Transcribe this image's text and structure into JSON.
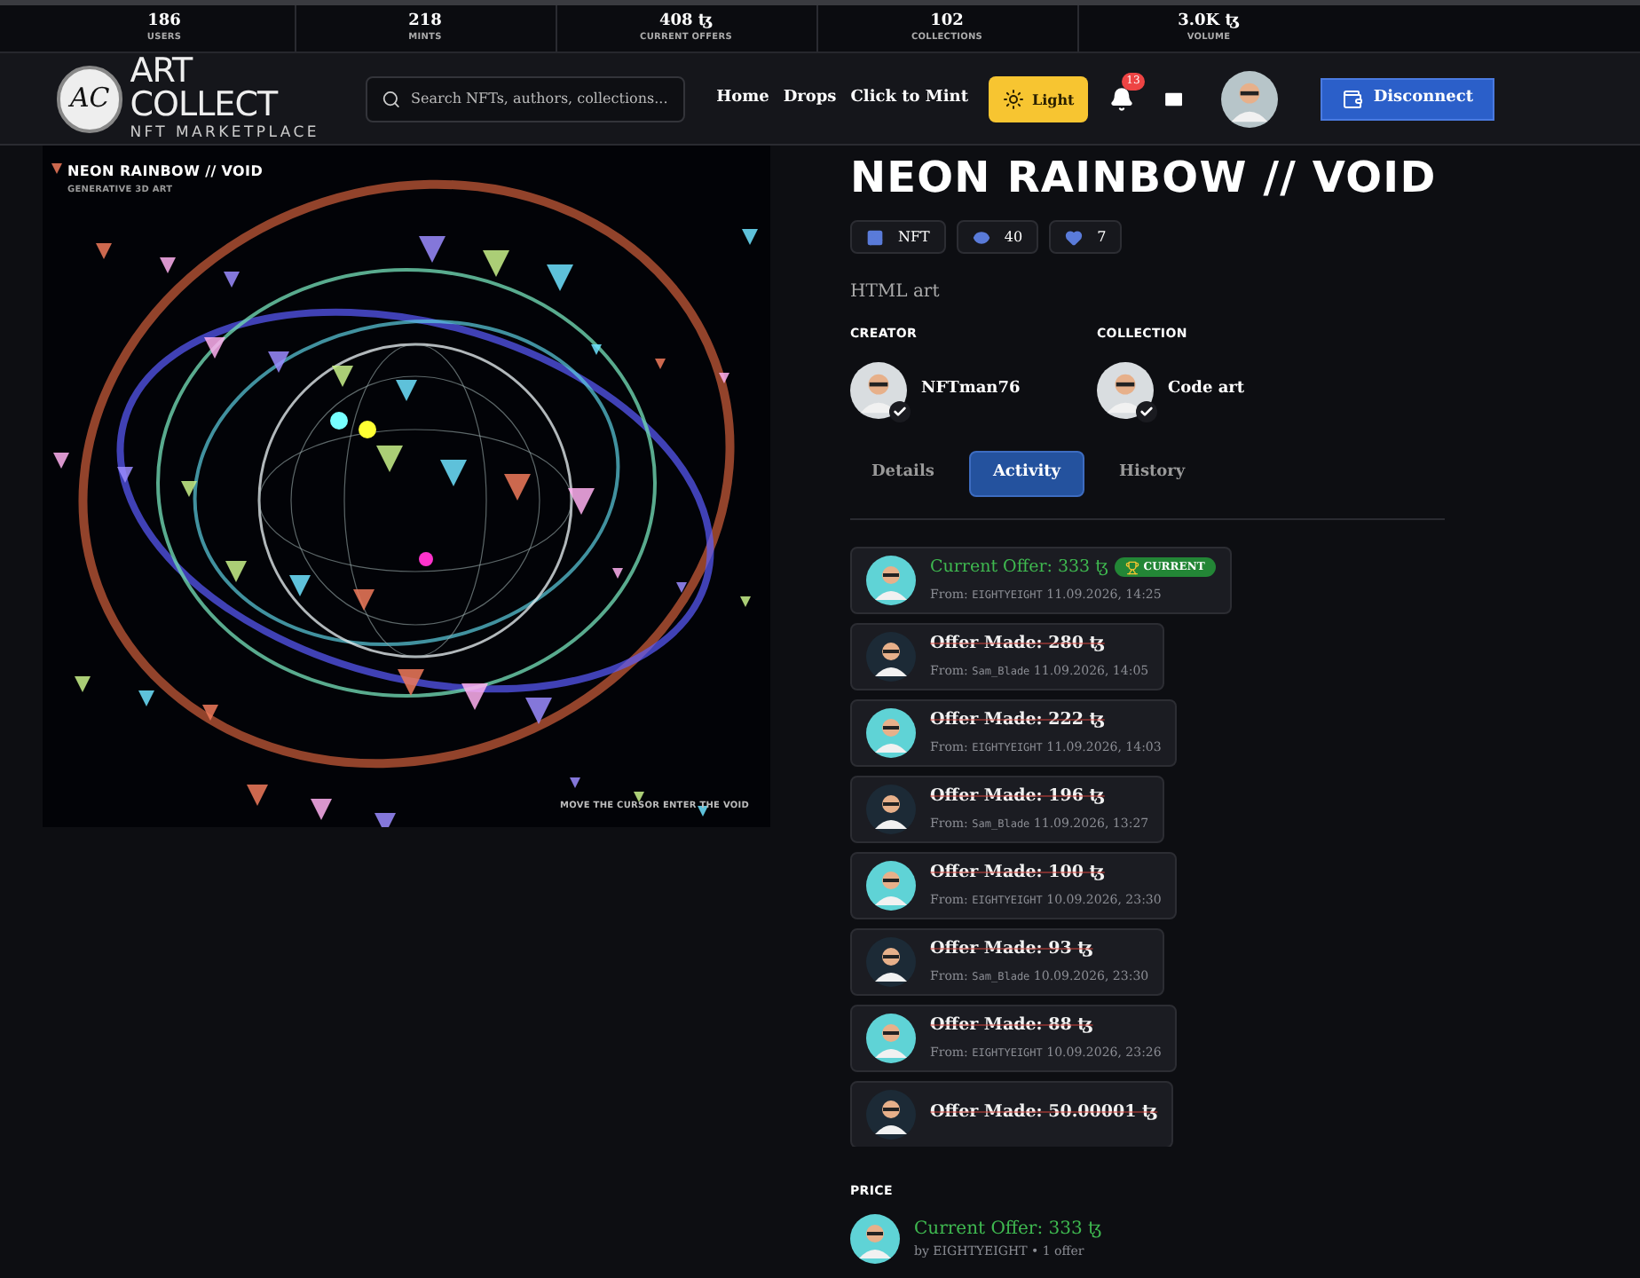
{
  "stats": [
    {
      "value": "186",
      "label": "USERS"
    },
    {
      "value": "218",
      "label": "MINTS"
    },
    {
      "value": "408 ꜩ",
      "label": "CURRENT OFFERS"
    },
    {
      "value": "102",
      "label": "COLLECTIONS"
    },
    {
      "value": "3.0K ꜩ",
      "label": "VOLUME"
    }
  ],
  "header": {
    "logo_mark": "AC",
    "logo_title": "ART COLLECT",
    "logo_subtitle": "NFT MARKETPLACE",
    "search": {
      "placeholder": "Search NFTs, authors, collections..."
    },
    "nav": [
      "Home",
      "Drops",
      "Click to Mint"
    ],
    "theme_button": "Light",
    "notification_count": "13",
    "disconnect_button": "Disconnect"
  },
  "artwork": {
    "title": "NEON RAINBOW // VOID",
    "subtitle": "GENERATIVE 3D ART",
    "hint": "MOVE THE CURSOR ENTER THE VOID"
  },
  "title": "NEON RAINBOW // VOID",
  "badges": [
    {
      "kind": "image",
      "text": "NFT"
    },
    {
      "kind": "views",
      "text": "40"
    },
    {
      "kind": "likes",
      "text": "7"
    }
  ],
  "description": "HTML art",
  "creator": {
    "label": "CREATOR",
    "name": "NFTman76",
    "verified": true
  },
  "collection": {
    "label": "COLLECTION",
    "name": "Code art",
    "verified": true
  },
  "tabs": [
    {
      "label": "Details",
      "selected": false
    },
    {
      "label": "Activity",
      "selected": true
    },
    {
      "label": "History",
      "selected": false
    }
  ],
  "activity": [
    {
      "kind": "current",
      "title": "Current Offer: 333 ꜩ",
      "badge": "CURRENT",
      "from_label": "From:",
      "from": "EIGHTYEIGHT",
      "date": "11.09.2026, 14:25",
      "color": "#5fd3d6"
    },
    {
      "kind": "outbid",
      "title": "Offer Made: 280 ꜩ",
      "from_label": "From:",
      "from": "Sam_Blade",
      "date": "11.09.2026, 14:05",
      "color": "#1c2a36"
    },
    {
      "kind": "outbid",
      "title": "Offer Made: 222 ꜩ",
      "from_label": "From:",
      "from": "EIGHTYEIGHT",
      "date": "11.09.2026, 14:03",
      "color": "#5fd3d6"
    },
    {
      "kind": "outbid",
      "title": "Offer Made: 196 ꜩ",
      "from_label": "From:",
      "from": "Sam_Blade",
      "date": "11.09.2026, 13:27",
      "color": "#1c2a36"
    },
    {
      "kind": "outbid",
      "title": "Offer Made: 100 ꜩ",
      "from_label": "From:",
      "from": "EIGHTYEIGHT",
      "date": "10.09.2026, 23:30",
      "color": "#5fd3d6"
    },
    {
      "kind": "outbid",
      "title": "Offer Made: 93 ꜩ",
      "from_label": "From:",
      "from": "Sam_Blade",
      "date": "10.09.2026, 23:30",
      "color": "#1c2a36"
    },
    {
      "kind": "outbid",
      "title": "Offer Made: 88 ꜩ",
      "from_label": "From:",
      "from": "EIGHTYEIGHT",
      "date": "10.09.2026, 23:26",
      "color": "#5fd3d6"
    },
    {
      "kind": "outbid",
      "title": "Offer Made: 50.00001 ꜩ",
      "color": "#1c2a36"
    }
  ],
  "price": {
    "label": "PRICE",
    "offer": "Current Offer: 333 ꜩ",
    "by": "by EIGHTYEIGHT • 1 offer"
  }
}
